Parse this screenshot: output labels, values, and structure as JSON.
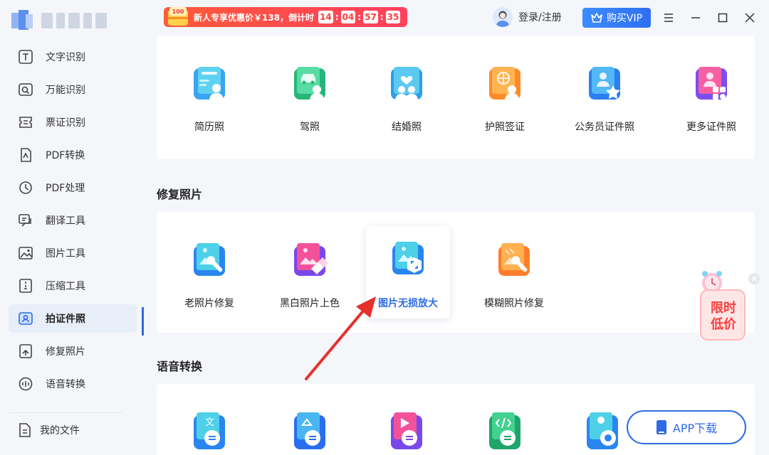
{
  "sidebar": {
    "items": [
      {
        "label": "文字识别",
        "icon": "text-recognition-icon"
      },
      {
        "label": "万能识别",
        "icon": "universal-scan-icon"
      },
      {
        "label": "票证识别",
        "icon": "ticket-icon"
      },
      {
        "label": "PDF转换",
        "icon": "pdf-convert-icon"
      },
      {
        "label": "PDF处理",
        "icon": "pdf-process-icon"
      },
      {
        "label": "翻译工具",
        "icon": "translate-icon"
      },
      {
        "label": "图片工具",
        "icon": "image-tool-icon"
      },
      {
        "label": "压缩工具",
        "icon": "compress-icon"
      },
      {
        "label": "拍证件照",
        "icon": "id-photo-icon",
        "active": true
      },
      {
        "label": "修复照片",
        "icon": "repair-photo-icon"
      },
      {
        "label": "语音转换",
        "icon": "voice-icon"
      }
    ],
    "my_files": "我的文件"
  },
  "topbar": {
    "promo_text": "新人专享优惠价￥138，倒计时",
    "promo_badge": "100",
    "countdown": [
      "14",
      "04",
      "57",
      "35"
    ],
    "login": "登录/注册",
    "vip": "购买VIP"
  },
  "id_photo": {
    "tiles": [
      {
        "label": "简历照",
        "icon": "resume-photo-icon"
      },
      {
        "label": "驾照",
        "icon": "driver-license-icon"
      },
      {
        "label": "结婚照",
        "icon": "marriage-photo-icon"
      },
      {
        "label": "护照签证",
        "icon": "passport-visa-icon"
      },
      {
        "label": "公务员证件照",
        "icon": "civil-servant-photo-icon"
      },
      {
        "label": "更多证件照",
        "icon": "more-id-photo-icon"
      }
    ]
  },
  "repair": {
    "title": "修复照片",
    "tiles": [
      {
        "label": "老照片修复",
        "icon": "old-photo-repair-icon"
      },
      {
        "label": "黑白照片上色",
        "icon": "colorize-photo-icon"
      },
      {
        "label": "图片无损放大",
        "icon": "lossless-enlarge-icon",
        "selected": true
      },
      {
        "label": "模糊照片修复",
        "icon": "blur-photo-repair-icon"
      }
    ]
  },
  "voice": {
    "title": "语音转换"
  },
  "float_promo": {
    "line1": "限时",
    "line2": "低价"
  },
  "app_download": "APP下载",
  "colors": {
    "accent": "#2e6be6",
    "promo_red": "#ff4a4a",
    "vip_blue": "#3e8bff"
  }
}
